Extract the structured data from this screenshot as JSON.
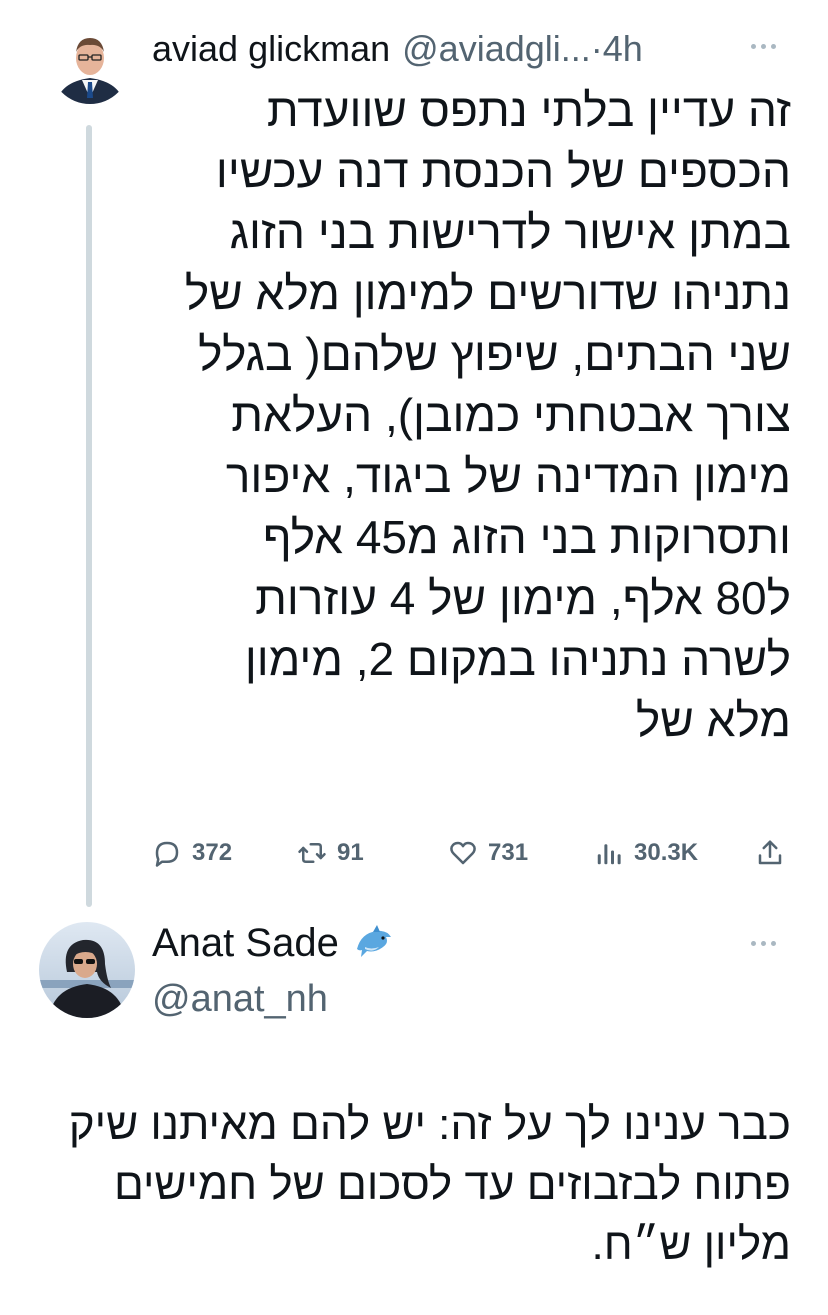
{
  "tweet1": {
    "author_name": "aviad glickman",
    "author_handle": "@aviadgli...",
    "separator": "·",
    "time": "4h",
    "text": "זה עדיין בלתי נתפס שוועדת\nהכספים של הכנסת דנה עכשיו\nבמתן אישור לדרישות בני הזוג\nנתניהו שדורשים למימון מלא של\nשני הבתים, שיפוץ שלהם( בגלל\nצורך אבטחתי כמובן), העלאת\nמימון המדינה של ביגוד, איפור\nותסרוקות בני הזוג מ45 אלף\nל80 אלף, מימון של 4 עוזרות\nלשרה נתניהו במקום 2, מימון\nמלא של",
    "actions": {
      "replies": "372",
      "retweets": "91",
      "likes": "731",
      "views": "30.3K"
    }
  },
  "tweet2": {
    "author_name": "Anat Sade",
    "author_handle": "@anat_nh",
    "text": "כבר ענינו לך על זה: יש להם מאיתנו שיק\nפתוח לבזבוזים עד לסכום של חמישים\nמליון ש״ח."
  },
  "icons": {
    "reply": "reply-icon",
    "retweet": "retweet-icon",
    "like": "heart-icon",
    "views": "views-icon",
    "share": "share-icon",
    "more": "more-icon",
    "dolphin": "dolphin-emoji-icon"
  },
  "colors": {
    "text_primary": "#0f1419",
    "text_secondary": "#536471",
    "thread_line": "#cfd9de"
  }
}
